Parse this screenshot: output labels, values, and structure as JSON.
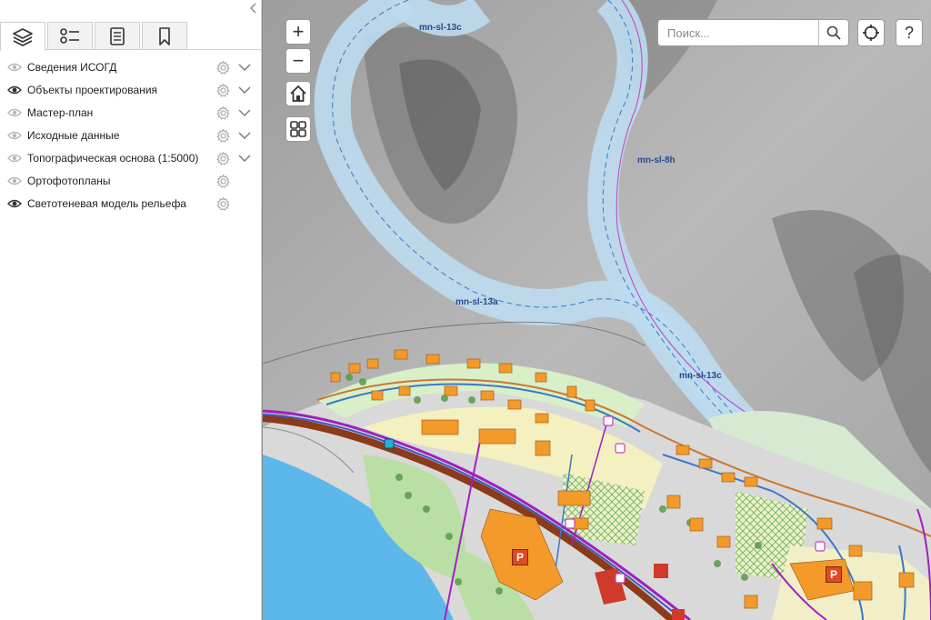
{
  "panel": {
    "tabs": [
      {
        "name": "layers",
        "icon": "layers-icon",
        "active": true
      },
      {
        "name": "legend",
        "icon": "legend-list-icon",
        "active": false
      },
      {
        "name": "document",
        "icon": "document-icon",
        "active": false
      },
      {
        "name": "bookmarks",
        "icon": "bookmark-icon",
        "active": false
      }
    ],
    "collapse_icon": "chevron-left-icon",
    "layers": [
      {
        "label": "Сведения ИСОГД",
        "visible": false,
        "expandable": true
      },
      {
        "label": "Объекты проектирования",
        "visible": true,
        "expandable": true
      },
      {
        "label": "Мастер-план",
        "visible": false,
        "expandable": true
      },
      {
        "label": "Исходные данные",
        "visible": false,
        "expandable": true
      },
      {
        "label": "Топографическая основа (1:5000)",
        "visible": false,
        "expandable": true
      },
      {
        "label": "Ортофотопланы",
        "visible": false,
        "expandable": false
      },
      {
        "label": "Светотеневая модель рельефа",
        "visible": true,
        "expandable": false
      }
    ]
  },
  "map": {
    "search": {
      "placeholder": "Поиск..."
    },
    "controls": {
      "zoom_in": "+",
      "zoom_out": "−",
      "help": "?"
    },
    "labels": [
      "mn-sl-13c",
      "mn-sl-8h",
      "mn-sl-13a",
      "mn-sl-13c"
    ],
    "parking_label": "P",
    "colors": {
      "water": "#5cb8ea",
      "corridor": "#bcdcf0",
      "building": "#f39a2b",
      "road_main": "#8b3a1a",
      "transit": "#a020c0",
      "green": "#b9dfa4"
    }
  }
}
